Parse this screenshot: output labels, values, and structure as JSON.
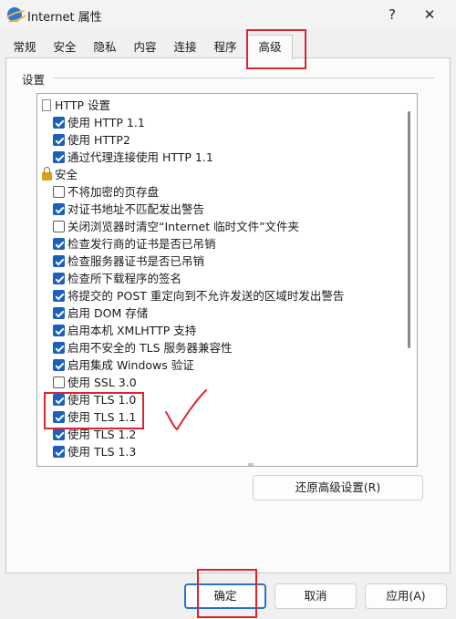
{
  "window": {
    "title": "Internet 属性",
    "help_label": "?",
    "close_label": "✕",
    "icon": "internet-options-icon"
  },
  "tabs": [
    {
      "label": "常规"
    },
    {
      "label": "安全"
    },
    {
      "label": "隐私"
    },
    {
      "label": "内容"
    },
    {
      "label": "连接"
    },
    {
      "label": "程序"
    },
    {
      "label": "高级",
      "active": true
    }
  ],
  "settings": {
    "section_label": "设置",
    "items": [
      {
        "kind": "header",
        "icon": "document-icon",
        "label": "HTTP 设置"
      },
      {
        "kind": "check",
        "checked": true,
        "label": "使用 HTTP 1.1"
      },
      {
        "kind": "check",
        "checked": true,
        "label": "使用 HTTP2"
      },
      {
        "kind": "check",
        "checked": true,
        "label": "通过代理连接使用 HTTP 1.1"
      },
      {
        "kind": "header",
        "icon": "lock-icon",
        "label": "安全"
      },
      {
        "kind": "check",
        "checked": false,
        "label": "不将加密的页存盘"
      },
      {
        "kind": "check",
        "checked": true,
        "label": "对证书地址不匹配发出警告"
      },
      {
        "kind": "check",
        "checked": false,
        "label": "关闭浏览器时清空“Internet 临时文件”文件夹"
      },
      {
        "kind": "check",
        "checked": true,
        "label": "检查发行商的证书是否已吊销"
      },
      {
        "kind": "check",
        "checked": true,
        "label": "检查服务器证书是否已吊销"
      },
      {
        "kind": "check",
        "checked": true,
        "label": "检查所下载程序的签名"
      },
      {
        "kind": "check",
        "checked": true,
        "label": "将提交的 POST 重定向到不允许发送的区域时发出警告"
      },
      {
        "kind": "check",
        "checked": true,
        "label": "启用 DOM 存储"
      },
      {
        "kind": "check",
        "checked": true,
        "label": "启用本机 XMLHTTP 支持"
      },
      {
        "kind": "check",
        "checked": true,
        "label": "启用不安全的 TLS 服务器兼容性"
      },
      {
        "kind": "check",
        "checked": true,
        "label": "启用集成 Windows 验证"
      },
      {
        "kind": "check",
        "checked": false,
        "label": "使用 SSL 3.0"
      },
      {
        "kind": "check",
        "checked": true,
        "label": "使用 TLS 1.0"
      },
      {
        "kind": "check",
        "checked": true,
        "label": "使用 TLS 1.1"
      },
      {
        "kind": "check",
        "checked": true,
        "label": "使用 TLS 1.2"
      },
      {
        "kind": "check",
        "checked": true,
        "label": "使用 TLS 1.3"
      }
    ]
  },
  "restore_button": "还原高级设置(R)",
  "footer": {
    "ok": "确定",
    "cancel": "取消",
    "apply": "应用(A)"
  },
  "colors": {
    "accent": "#1b5fbf",
    "annotation": "#e0242e"
  }
}
